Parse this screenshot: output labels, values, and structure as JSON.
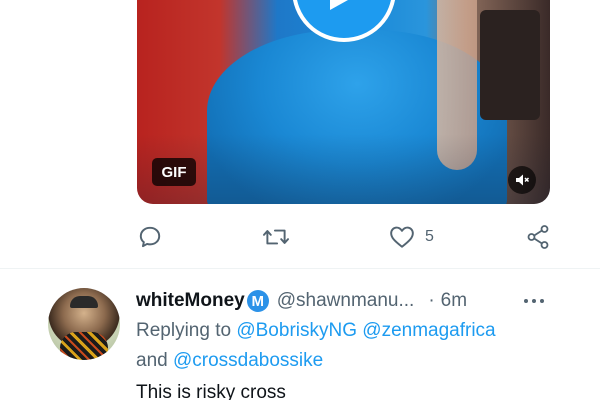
{
  "media": {
    "badge": "GIF",
    "play_icon": "play-icon",
    "mute_icon": "speaker-mute-icon"
  },
  "actions": {
    "reply_icon": "reply-icon",
    "retweet_icon": "retweet-icon",
    "like_icon": "heart-icon",
    "like_count": "5",
    "share_icon": "share-icon"
  },
  "reply": {
    "display_name": "whiteMoney",
    "verified_letter": "M",
    "handle": "@shawnmanu...",
    "separator": "·",
    "time": "6m",
    "replying_to_label": "Replying to",
    "mention_1": "@BobriskyNG",
    "mention_2": "@zenmagafrica",
    "and_label": "and",
    "mention_3": "@crossdabossike",
    "text": "This is risky cross",
    "more_icon": "more-horizontal-icon"
  },
  "colors": {
    "accent": "#1d9bf0",
    "text_primary": "#0f1419",
    "text_secondary": "#536471"
  }
}
